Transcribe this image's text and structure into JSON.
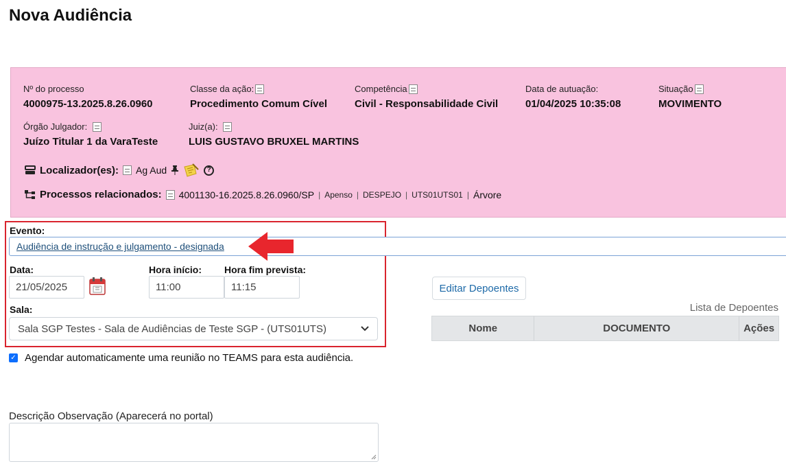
{
  "page": {
    "title": "Nova Audiência"
  },
  "process": {
    "numero": {
      "label": "Nº do processo",
      "value": "4000975-13.2025.8.26.0960"
    },
    "classe": {
      "label": "Classe da ação:",
      "value": "Procedimento Comum Cível"
    },
    "competencia": {
      "label": "Competência",
      "value": "Civil - Responsabilidade Civil"
    },
    "data_autuacao": {
      "label": "Data de autuação:",
      "value": "01/04/2025 10:35:08"
    },
    "situacao": {
      "label": "Situação",
      "value": "MOVIMENTO"
    },
    "orgao": {
      "label": "Órgão Julgador:",
      "value": "Juízo Titular 1 da VaraTeste"
    },
    "juiz": {
      "label": "Juiz(a):",
      "value": "LUIS GUSTAVO BRUXEL MARTINS"
    },
    "localizadores": {
      "label": "Localizador(es):",
      "value": "Ag Aud"
    },
    "relacionados": {
      "label": "Processos relacionados:",
      "numero": "4001130-16.2025.8.26.0960/SP",
      "tipo": "Apenso",
      "classe": "DESPEJO",
      "orgao": "UTS01UTS01",
      "arvore": "Árvore"
    }
  },
  "form": {
    "evento_label": "Evento:",
    "evento_value": "Audiência de instrução e julgamento - designada",
    "data_label": "Data:",
    "data_value": "21/05/2025",
    "hora_inicio_label": "Hora início:",
    "hora_inicio_value": "11:00",
    "hora_fim_label": "Hora fim prevista:",
    "hora_fim_value": "11:15",
    "sala_label": "Sala:",
    "sala_value": "Sala SGP Testes - Sala de Audiências de Teste SGP - (UTS01UTS)",
    "teams_label": "Agendar automaticamente uma reunião no TEAMS para esta audiência.",
    "teams_checked": true,
    "descricao_label": "Descrição Observação (Aparecerá no portal)"
  },
  "depoentes": {
    "button_label": "Editar Depoentes",
    "caption": "Lista de Depoentes",
    "columns": [
      "Nome",
      "DOCUMENTO",
      "Ações"
    ]
  },
  "icons": {
    "pin": "pin-icon",
    "notes": "sticky-note-icon",
    "help": "help-icon",
    "calendar": "calendar-icon",
    "localizador": "tray-icon",
    "tree": "tree-icon"
  },
  "colors": {
    "process_bg": "#f9c3df",
    "highlight_frame": "#d9232d",
    "link": "#1e4f7a",
    "checkbox": "#0d6efd"
  }
}
